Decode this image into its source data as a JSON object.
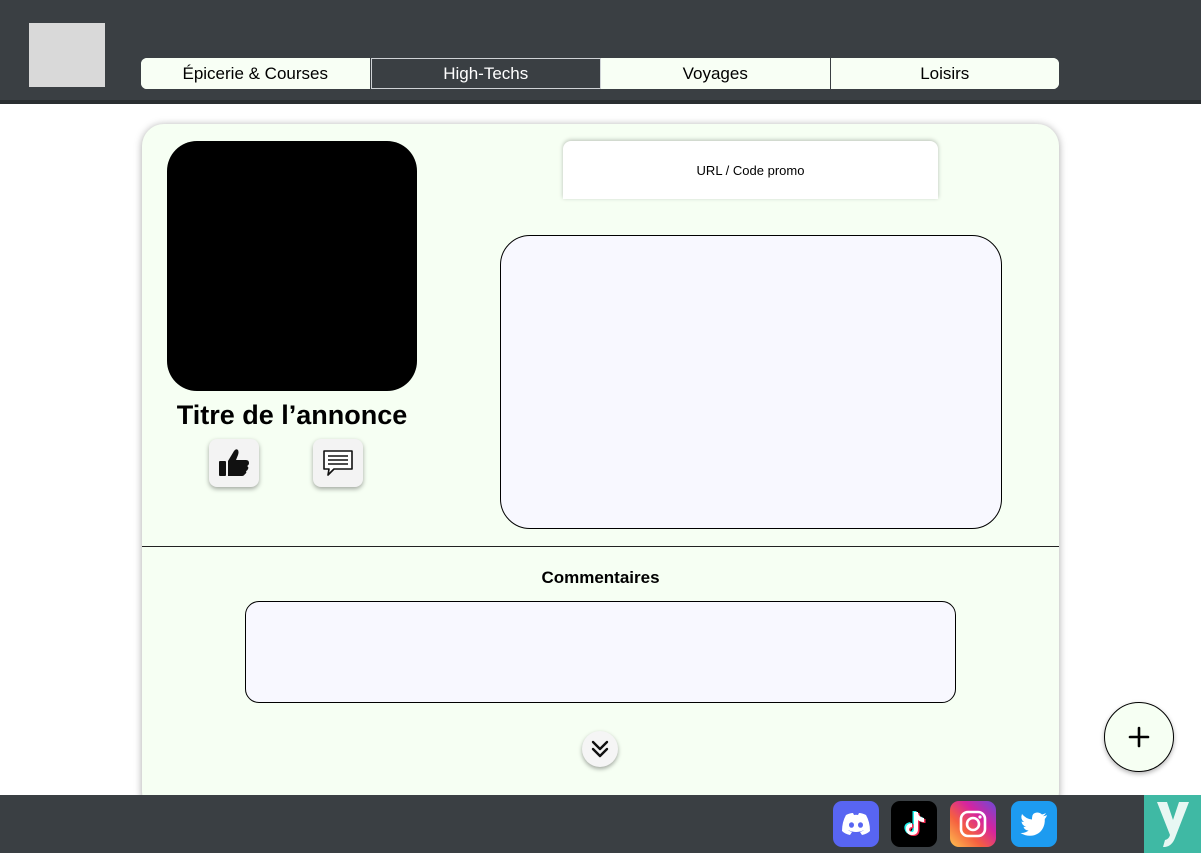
{
  "header": {
    "tabs": [
      {
        "label": "Épicerie & Courses",
        "active": false
      },
      {
        "label": "High-Techs",
        "active": true
      },
      {
        "label": "Voyages",
        "active": false
      },
      {
        "label": "Loisirs",
        "active": false
      }
    ]
  },
  "ad": {
    "title": "Titre de l’annonce",
    "promo_label": "URL / Code promo",
    "like_icon": "thumbs-up-icon",
    "comment_icon": "speech-bubble-icon"
  },
  "comments": {
    "label": "Commentaires",
    "more_icon": "double-chevron-down-icon"
  },
  "fab": {
    "label": "+"
  },
  "footer": {
    "socials": [
      "discord-icon",
      "tiktok-icon",
      "instagram-icon",
      "twitter-icon"
    ],
    "brand_logo_text": "y"
  },
  "colors": {
    "header_bg": "#3a3f43",
    "card_bg": "#f6fff3",
    "brand_accent": "#3fb9a4"
  }
}
